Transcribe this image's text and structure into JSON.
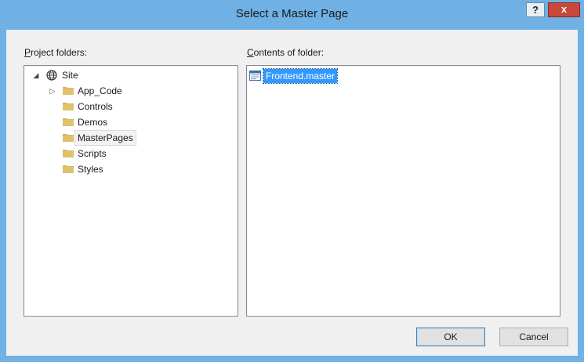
{
  "window": {
    "title": "Select a Master Page",
    "help_label": "?",
    "close_label": "x"
  },
  "left": {
    "label_access": "P",
    "label_rest": "roject folders:",
    "tree": [
      {
        "label": "Site",
        "icon": "globe-icon",
        "expander": "◢",
        "level": 0
      },
      {
        "label": "App_Code",
        "icon": "folder-icon",
        "expander": "▷",
        "level": 1
      },
      {
        "label": "Controls",
        "icon": "folder-icon",
        "expander": "",
        "level": 1
      },
      {
        "label": "Demos",
        "icon": "folder-icon",
        "expander": "",
        "level": 1
      },
      {
        "label": "MasterPages",
        "icon": "folder-icon",
        "expander": "",
        "level": 1,
        "selected": true
      },
      {
        "label": "Scripts",
        "icon": "folder-icon",
        "expander": "",
        "level": 1
      },
      {
        "label": "Styles",
        "icon": "folder-icon",
        "expander": "",
        "level": 1
      }
    ]
  },
  "right": {
    "label_access": "C",
    "label_rest": "ontents of folder:",
    "files": [
      {
        "label": "Frontend.master",
        "icon": "master-file-icon",
        "selected": true
      }
    ]
  },
  "buttons": {
    "ok": "OK",
    "cancel": "Cancel"
  },
  "colors": {
    "title_bar": "#6fb1e4",
    "close_button": "#c8483c",
    "folder": "#d8b65a",
    "selection": "#3399ff"
  }
}
